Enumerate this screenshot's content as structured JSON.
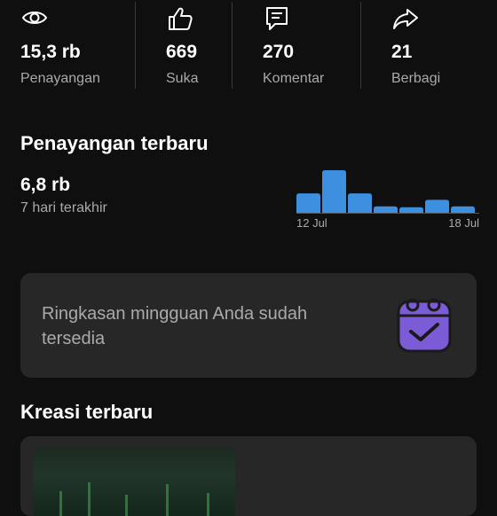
{
  "stats": [
    {
      "icon": "eye-icon",
      "value": "15,3 rb",
      "label": "Penayangan"
    },
    {
      "icon": "thumb-up-icon",
      "value": "669",
      "label": "Suka"
    },
    {
      "icon": "comment-icon",
      "value": "270",
      "label": "Komentar"
    },
    {
      "icon": "share-icon",
      "value": "21",
      "label": "Berbagi"
    }
  ],
  "recent_views": {
    "title": "Penayangan terbaru",
    "value": "6,8 rb",
    "subtitle": "7 hari terakhir"
  },
  "chart_data": {
    "type": "bar",
    "categories": [
      "12 Jul",
      "13 Jul",
      "14 Jul",
      "15 Jul",
      "16 Jul",
      "17 Jul",
      "18 Jul"
    ],
    "values": [
      1.05,
      2.3,
      1.05,
      0.35,
      0.3,
      0.7,
      0.35
    ],
    "xtick_labels": [
      "12 Jul",
      "18 Jul"
    ],
    "color": "#3d8fe0",
    "ylabel": "",
    "xlabel": ""
  },
  "weekly_summary": {
    "text": "Ringkasan mingguan Anda sudah tersedia",
    "icon": "calendar-check-icon",
    "icon_color": "#7b5bd6"
  },
  "recent_creations": {
    "title": "Kreasi terbaru"
  },
  "colors": {
    "background": "#0f0f0f",
    "card": "#272727",
    "secondary_text": "#aaaaaa",
    "bar": "#3d8fe0"
  }
}
